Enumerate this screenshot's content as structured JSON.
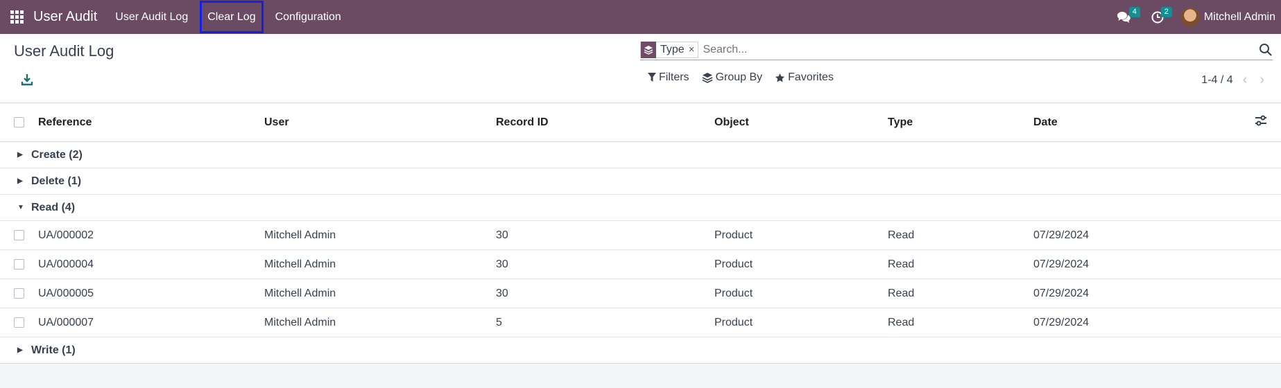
{
  "navbar": {
    "app_name": "User Audit",
    "menu": [
      {
        "label": "User Audit Log"
      },
      {
        "label": "Clear Log"
      },
      {
        "label": "Configuration"
      }
    ],
    "messages_count": "4",
    "activities_count": "2",
    "user_name": "Mitchell Admin"
  },
  "control_panel": {
    "title": "User Audit Log",
    "search": {
      "facet_label": "Type",
      "placeholder": "Search..."
    },
    "filters_label": "Filters",
    "group_by_label": "Group By",
    "favorites_label": "Favorites",
    "pager_value": "1-4 / 4"
  },
  "list": {
    "columns": [
      "Reference",
      "User",
      "Record ID",
      "Object",
      "Type",
      "Date"
    ],
    "groups": [
      {
        "label": "Create (2)",
        "expanded": false
      },
      {
        "label": "Delete (1)",
        "expanded": false
      },
      {
        "label": "Read (4)",
        "expanded": true
      },
      {
        "label": "Write (1)",
        "expanded": false
      }
    ],
    "rows": [
      {
        "reference": "UA/000002",
        "user": "Mitchell Admin",
        "record_id": "30",
        "object": "Product",
        "type": "Read",
        "date": "07/29/2024"
      },
      {
        "reference": "UA/000004",
        "user": "Mitchell Admin",
        "record_id": "30",
        "object": "Product",
        "type": "Read",
        "date": "07/29/2024"
      },
      {
        "reference": "UA/000005",
        "user": "Mitchell Admin",
        "record_id": "30",
        "object": "Product",
        "type": "Read",
        "date": "07/29/2024"
      },
      {
        "reference": "UA/000007",
        "user": "Mitchell Admin",
        "record_id": "5",
        "object": "Product",
        "type": "Read",
        "date": "07/29/2024"
      }
    ]
  },
  "colors": {
    "navbar": "#6b4b64",
    "badge": "#148f8f",
    "active_outline": "#1420e6"
  }
}
